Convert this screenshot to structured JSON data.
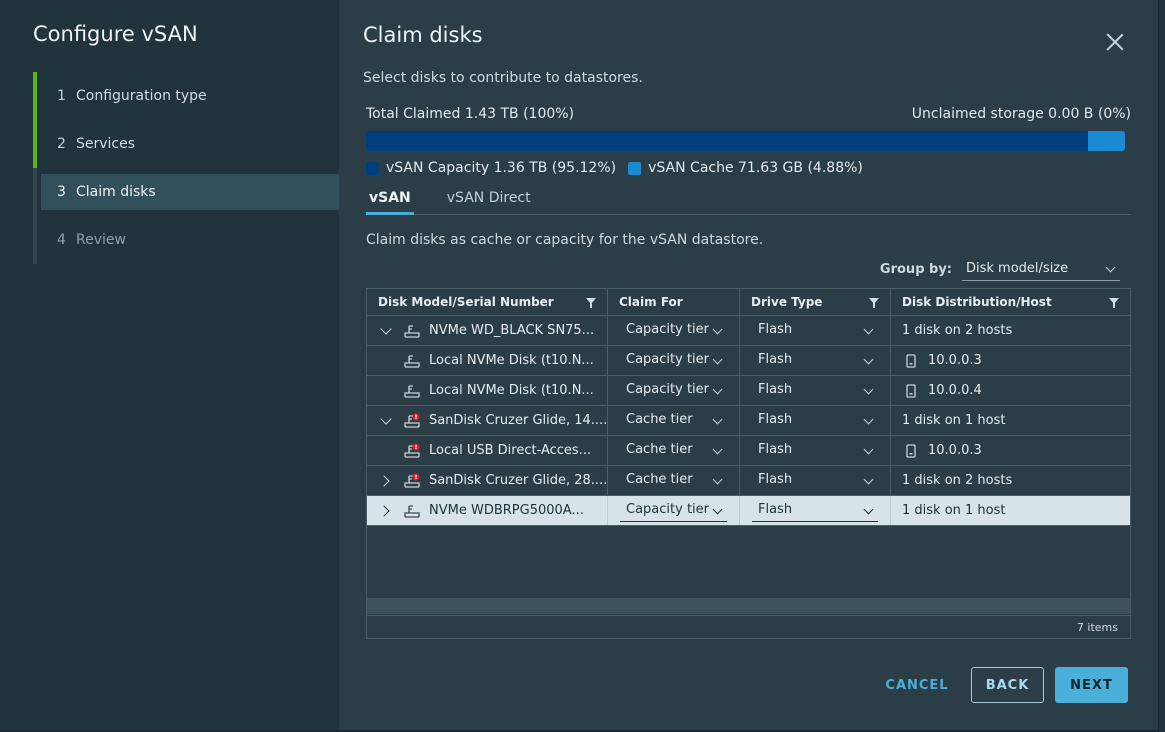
{
  "sidebar": {
    "title": "Configure vSAN",
    "steps": [
      {
        "num": "1",
        "label": "Configuration type"
      },
      {
        "num": "2",
        "label": "Services"
      },
      {
        "num": "3",
        "label": "Claim disks"
      },
      {
        "num": "4",
        "label": "Review"
      }
    ]
  },
  "main": {
    "title": "Claim disks",
    "subtitle": "Select disks to contribute to datastores.",
    "total_claimed": "Total Claimed 1.43 TB (100%)",
    "unclaimed": "Unclaimed storage 0.00 B (0%)",
    "capacity_fraction": 0.9512,
    "legend": [
      {
        "label": "vSAN Capacity 1.36 TB (95.12%)",
        "color": "#003e7e"
      },
      {
        "label": "vSAN Cache 71.63 GB (4.88%)",
        "color": "#1a8bd0"
      }
    ],
    "tabs": [
      "vSAN",
      "vSAN Direct"
    ],
    "claim_desc": "Claim disks as cache or capacity for the vSAN datastore.",
    "group_by_label": "Group by:",
    "group_by_value": "Disk model/size"
  },
  "grid": {
    "columns": [
      "Disk Model/Serial Number",
      "Claim For",
      "Drive Type",
      "Disk Distribution/Host"
    ],
    "rows": [
      {
        "name": "NVMe WD_BLACK SN75...",
        "claim": "Capacity tier",
        "drive": "Flash",
        "dist": "1 disk on 2 hosts"
      },
      {
        "name": "Local NVMe Disk (t10.N...",
        "claim": "Capacity tier",
        "drive": "Flash",
        "dist": "10.0.0.3"
      },
      {
        "name": "Local NVMe Disk (t10.N...",
        "claim": "Capacity tier",
        "drive": "Flash",
        "dist": "10.0.0.4"
      },
      {
        "name": "SanDisk Cruzer Glide, 14....",
        "claim": "Cache tier",
        "drive": "Flash",
        "dist": "1 disk on 1 host"
      },
      {
        "name": "Local USB Direct-Acces...",
        "claim": "Cache tier",
        "drive": "Flash",
        "dist": "10.0.0.3"
      },
      {
        "name": "SanDisk Cruzer Glide, 28....",
        "claim": "Cache tier",
        "drive": "Flash",
        "dist": "1 disk on 2 hosts"
      },
      {
        "name": "NVMe WDBRPG5000A...",
        "claim": "Capacity tier",
        "drive": "Flash",
        "dist": "1 disk on 1 host"
      }
    ],
    "footer": "7 items"
  },
  "buttons": {
    "cancel": "CANCEL",
    "back": "BACK",
    "next": "NEXT"
  },
  "icons": {
    "close": "close-icon",
    "filter": "filter-icon",
    "disk": "disk-icon",
    "disk_warning": "disk-warning-icon",
    "host": "host-icon"
  }
}
